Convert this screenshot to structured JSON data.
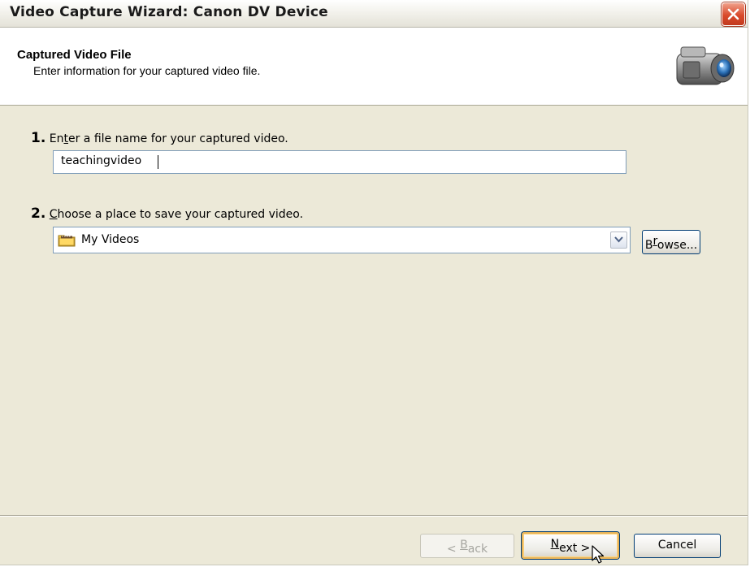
{
  "window": {
    "title": "Video Capture Wizard: Canon DV Device"
  },
  "header": {
    "title": "Captured Video File",
    "subtitle": "Enter information for your captured video file."
  },
  "steps": {
    "step1": {
      "number": "1.",
      "label_prefix": "En",
      "label_accel": "t",
      "label_suffix": "er a file name for your captured video.",
      "value": "teachingvideo"
    },
    "step2": {
      "number": "2.",
      "label_accel": "C",
      "label_suffix": "hoose a place to save your captured video.",
      "selected": "My Videos",
      "browse_prefix": "B",
      "browse_accel": "r",
      "browse_suffix": "owse..."
    }
  },
  "footer": {
    "back_prefix": "< ",
    "back_accel": "B",
    "back_suffix": "ack",
    "next_accel": "N",
    "next_suffix": "ext >",
    "cancel_label": "Cancel"
  },
  "icons": {
    "close": "close-icon",
    "camera": "video-camera-icon",
    "folder": "folder-icon",
    "dropdown": "chevron-down-icon",
    "cursor": "mouse-pointer-icon"
  },
  "colors": {
    "close_button": "#d94a2c",
    "next_focus": "#e6b35a",
    "dialog_background": "#ece9d8"
  }
}
